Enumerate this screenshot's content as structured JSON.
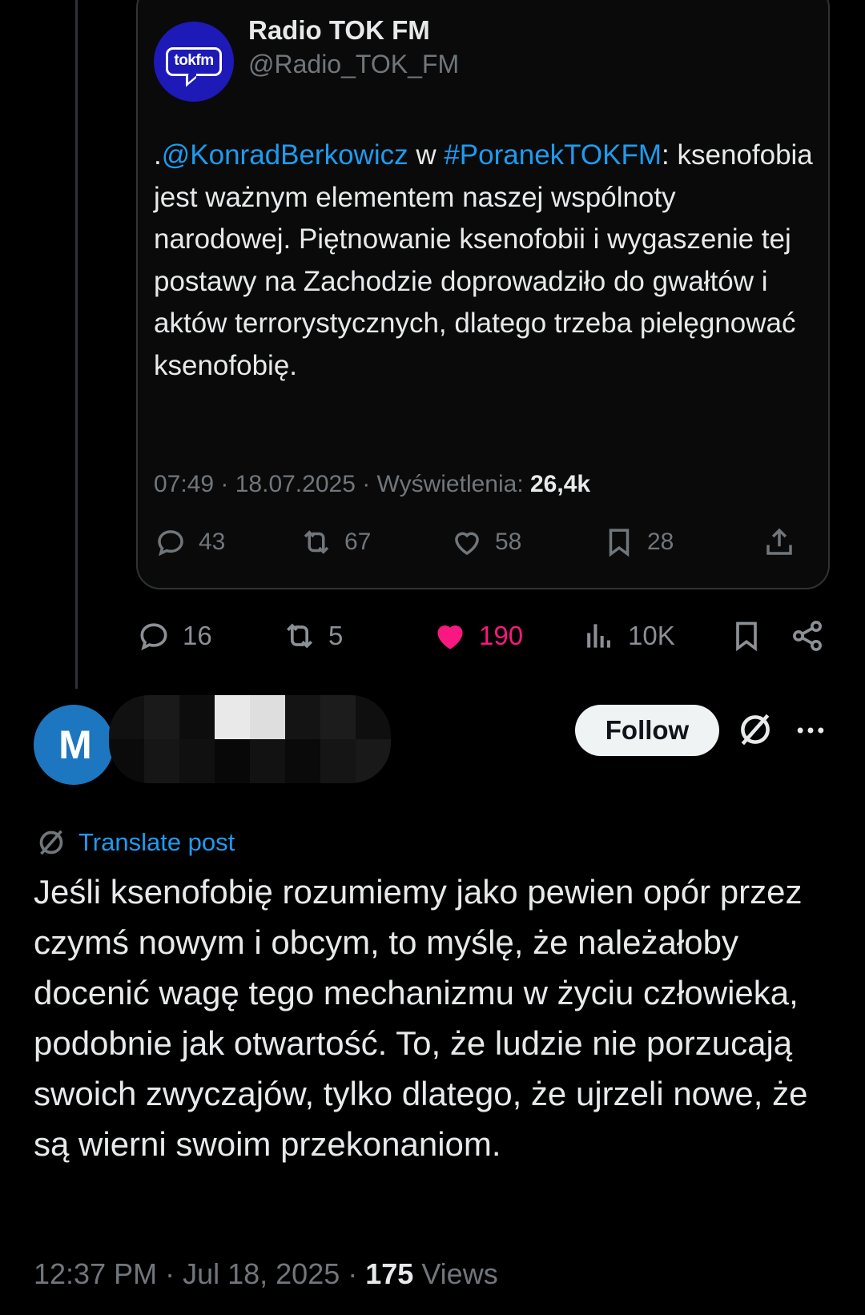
{
  "quoted_post": {
    "avatar_logo_text": "tokfm",
    "display_name": "Radio TOK FM",
    "handle": "@Radio_TOK_FM",
    "text_prefix": ".",
    "mention": "@KonradBerkowicz",
    "text_middle": " w ",
    "hashtag": "#PoranekTOKFM",
    "text_body": ": ksenofobia jest ważnym elementem naszej wspólnoty narodowej. Piętnowanie ksenofobii i wygaszenie tej postawy na Zachodzie doprowadziło do gwałtów i aktów terrorystycznych, dlatego trzeba pielęgnować ksenofobię.",
    "meta_time": "07:49 · 18.07.2025 · Wyświetlenia: ",
    "meta_views": "26,4k",
    "replies": "43",
    "reposts": "67",
    "likes": "58",
    "bookmarks": "28"
  },
  "main_post_actions": {
    "replies": "16",
    "reposts": "5",
    "likes": "190",
    "views": "10K"
  },
  "reply_post": {
    "avatar_initial": "M",
    "follow_label": "Follow",
    "translate_label": "Translate post",
    "text": "Jeśli ksenofobię rozumiemy jako pewien opór przez czymś nowym i obcym, to myślę, że należałoby docenić wagę tego mechanizmu w życiu człowieka, podobnie jak otwartość. To, że ludzie nie porzucają swoich zwyczajów, tylko dlatego, że ujrzeli nowe, że są wierni swoim przekonaniom.",
    "meta_time": "12:37 PM · Jul 18, 2025 · ",
    "meta_views": "175",
    "meta_views_label": " Views"
  },
  "colors": {
    "background": "#000000",
    "link": "#1d9bf0",
    "like": "#f91880",
    "muted": "#71767b",
    "tokfm_avatar": "#1d1ab8",
    "reply_avatar": "#1d76c0"
  }
}
